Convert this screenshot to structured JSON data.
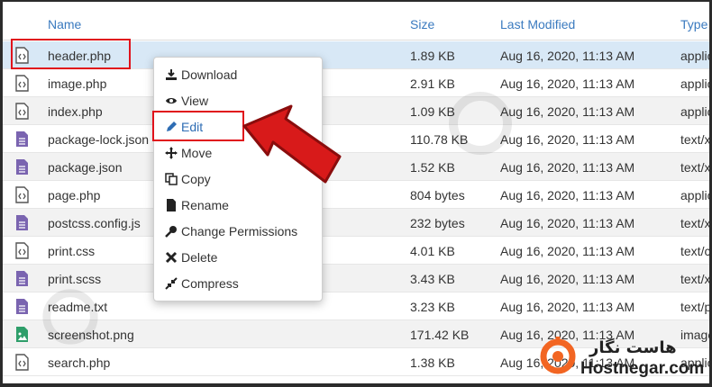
{
  "columns": {
    "name": "Name",
    "size": "Size",
    "modified": "Last Modified",
    "type": "Type"
  },
  "files": [
    {
      "name": "header.php",
      "size": "1.89 KB",
      "modified": "Aug 16, 2020, 11:13 AM",
      "type": "applic",
      "icon": "code-file-icon"
    },
    {
      "name": "image.php",
      "size": "2.91 KB",
      "modified": "Aug 16, 2020, 11:13 AM",
      "type": "applic",
      "icon": "code-file-icon"
    },
    {
      "name": "index.php",
      "size": "1.09 KB",
      "modified": "Aug 16, 2020, 11:13 AM",
      "type": "applic",
      "icon": "code-file-icon"
    },
    {
      "name": "package-lock.json",
      "size": "110.78 KB",
      "modified": "Aug 16, 2020, 11:13 AM",
      "type": "text/x",
      "icon": "text-file-icon"
    },
    {
      "name": "package.json",
      "size": "1.52 KB",
      "modified": "Aug 16, 2020, 11:13 AM",
      "type": "text/x",
      "icon": "text-file-icon"
    },
    {
      "name": "page.php",
      "size": "804 bytes",
      "modified": "Aug 16, 2020, 11:13 AM",
      "type": "applic",
      "icon": "code-file-icon"
    },
    {
      "name": "postcss.config.js",
      "size": "232 bytes",
      "modified": "Aug 16, 2020, 11:13 AM",
      "type": "text/x",
      "icon": "text-file-icon"
    },
    {
      "name": "print.css",
      "size": "4.01 KB",
      "modified": "Aug 16, 2020, 11:13 AM",
      "type": "text/c",
      "icon": "code-file-icon"
    },
    {
      "name": "print.scss",
      "size": "3.43 KB",
      "modified": "Aug 16, 2020, 11:13 AM",
      "type": "text/x",
      "icon": "text-file-icon"
    },
    {
      "name": "readme.txt",
      "size": "3.23 KB",
      "modified": "Aug 16, 2020, 11:13 AM",
      "type": "text/p",
      "icon": "text-file-icon"
    },
    {
      "name": "screenshot.png",
      "size": "171.42 KB",
      "modified": "Aug 16, 2020, 11:13 AM",
      "type": "image",
      "icon": "image-file-icon"
    },
    {
      "name": "search.php",
      "size": "1.38 KB",
      "modified": "Aug 16, 2020, 11:13 AM",
      "type": "applic",
      "icon": "code-file-icon"
    }
  ],
  "context_menu": [
    {
      "label": "Download",
      "icon": "download-icon"
    },
    {
      "label": "View",
      "icon": "eye-icon"
    },
    {
      "label": "Edit",
      "icon": "pencil-icon"
    },
    {
      "label": "Move",
      "icon": "move-arrows-icon"
    },
    {
      "label": "Copy",
      "icon": "copy-icon"
    },
    {
      "label": "Rename",
      "icon": "file-icon"
    },
    {
      "label": "Change Permissions",
      "icon": "key-icon"
    },
    {
      "label": "Delete",
      "icon": "close-icon"
    },
    {
      "label": "Compress",
      "icon": "compress-icon"
    }
  ],
  "brand": {
    "name_fa": "هاست نگار",
    "name_en": "Hostnegar.com"
  },
  "colors": {
    "accent": "#3a7abf",
    "highlight": "#e0121b",
    "selected_row": "#d8e8f6",
    "brand_orange": "#f26522"
  }
}
